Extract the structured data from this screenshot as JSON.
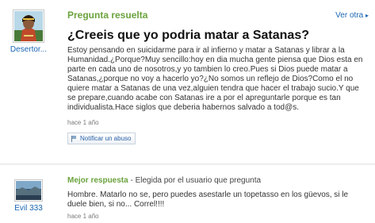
{
  "question": {
    "status": "Pregunta resuelta",
    "see_others": "Ver otra",
    "title": "¿Creeis que yo podria matar a Satanas?",
    "body": "Estoy pensando en suicidarme para ir al infierno y matar a Satanas y librar a la Humanidad.¿Porque?Muy sencillo:hoy en dia mucha gente piensa que Dios esta en parte en cada uno de nosotros,y yo tambien lo creo.Pues si Dios puede matar a Satanas,¿porque no voy a hacerlo yo?¿No somos un reflejo de Dios?Como el no quiere matar a Satanas de una vez,alguien tendra que hacer el trabajo sucio.Y que se prepare,cuando acabe con Satanas ire a por el apreguntarle porque es tan individualista.Hace siglos que deberia habernos salvado a tod@s.",
    "time": "hace 1 año",
    "report_label": "Notificar un abuso",
    "asker": {
      "name": "Desertor..."
    }
  },
  "best_answer": {
    "label": "Mejor respuesta",
    "chosen_by": "- Elegida por el usuario que pregunta",
    "body": "Hombre. Matarlo no se, pero puedes asestarle un topetasso en los güevos, si le duele bien, si no... Correl!!!!",
    "time": "hace 1 año",
    "answerer": {
      "name": "Evil 333"
    }
  },
  "colors": {
    "accent_green": "#6aa23d",
    "link_blue": "#1a66b3"
  }
}
